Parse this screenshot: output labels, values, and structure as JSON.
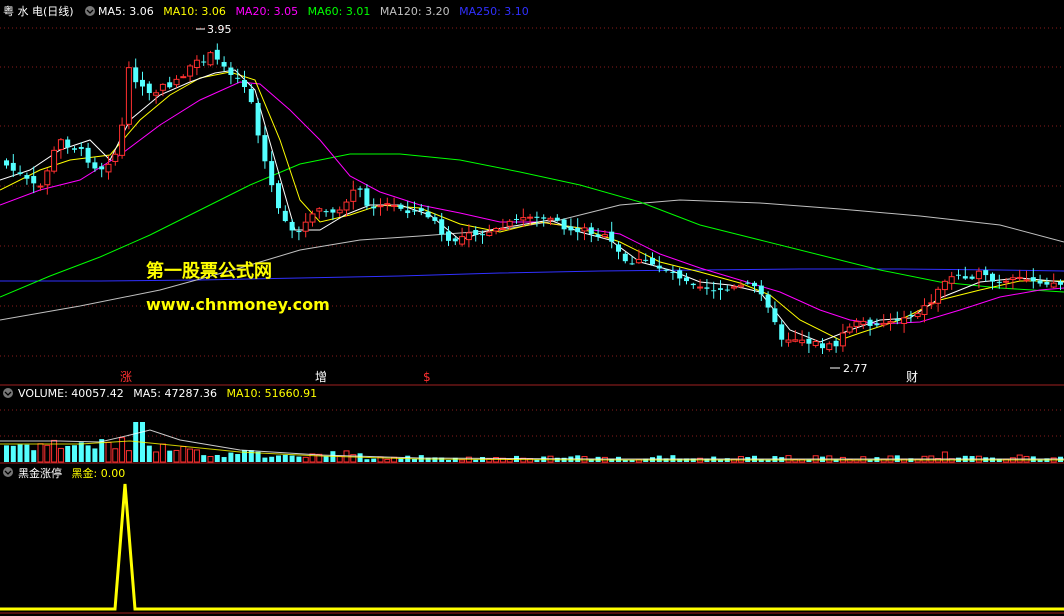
{
  "price_panel": {
    "stock_name": "粤 水 电(日线)",
    "ma_legend": [
      {
        "label": "MA5: 3.06",
        "color": "#ffffff"
      },
      {
        "label": "MA10: 3.06",
        "color": "#ffff00"
      },
      {
        "label": "MA20: 3.05",
        "color": "#ff00ff"
      },
      {
        "label": "MA60: 3.01",
        "color": "#00ff00"
      },
      {
        "label": "MA120: 3.20",
        "color": "#c0c0c0"
      },
      {
        "label": "MA250: 3.10",
        "color": "#3030ff"
      }
    ],
    "high_label": "3.95",
    "low_label": "2.77",
    "event_markers": [
      {
        "text": "涨",
        "color": "#ff3030"
      },
      {
        "text": "增",
        "color": "#ffffff"
      },
      {
        "text": "$",
        "color": "#ff3030"
      },
      {
        "text": "财",
        "color": "#ffffff"
      }
    ],
    "watermark_cn": "第一股票公式网",
    "watermark_url": "www.chnmoney.com"
  },
  "volume_panel": {
    "label": "VOLUME: 40057.42",
    "ma5": "MA5: 47287.36",
    "ma10": "MA10: 51660.91"
  },
  "indicator_panel": {
    "name": "黑金涨停",
    "series_label": "黑金: 0.00"
  },
  "colors": {
    "up": "#ff3030",
    "down": "#54ffff",
    "grid": "#8a1c1c",
    "indicator": "#ffff00"
  },
  "chart_data": {
    "type": "candlestick",
    "price_range": [
      2.7,
      4.0
    ],
    "high": 3.95,
    "low": 2.77,
    "indicator_values": [
      0,
      0,
      0,
      0,
      0,
      0,
      0,
      0,
      0,
      0,
      0,
      0,
      0,
      0,
      0,
      0,
      0,
      0,
      0,
      0,
      0,
      0,
      0,
      0,
      0,
      0,
      0,
      0,
      1,
      0,
      0
    ]
  }
}
